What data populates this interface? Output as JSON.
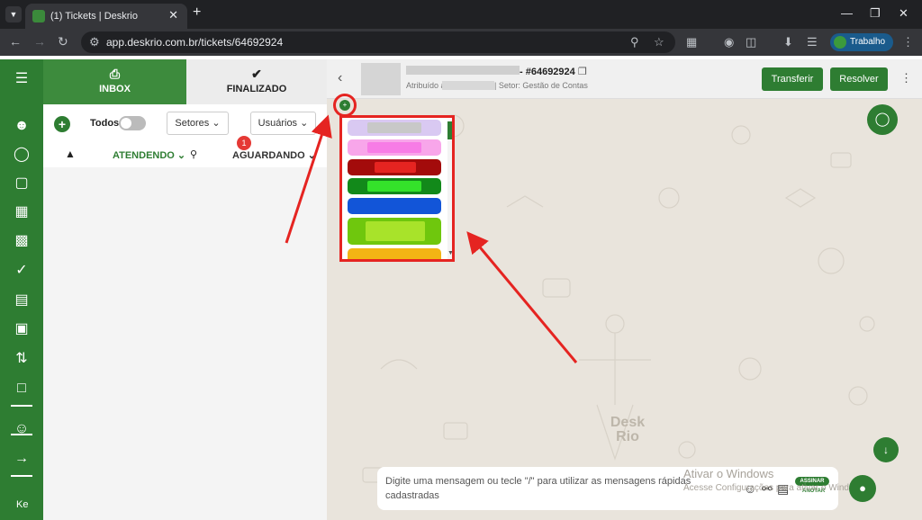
{
  "browser": {
    "tab_title": "(1) Tickets | Deskrio",
    "url": "app.deskrio.com.br/tickets/64692924",
    "profile_label": "Trabalho"
  },
  "rail": {
    "user_initials": "Ke",
    "icons": [
      "menu-icon",
      "user-icon",
      "chat-icon",
      "contacts-icon",
      "dashboard-icon",
      "kanban-icon",
      "check-icon",
      "calendar-icon",
      "quick-reply-icon",
      "flow-icon",
      "feedback-icon",
      "users-icon",
      "logout-icon"
    ]
  },
  "panel": {
    "tab_inbox": "INBOX",
    "tab_finalizado": "FINALIZADO",
    "todos_label": "Todos",
    "setores_label": "Setores",
    "usuarios_label": "Usuários",
    "atendendo_label": "ATENDENDO",
    "aguardando_label": "AGUARDANDO",
    "aguardando_count": "1"
  },
  "chat": {
    "ticket_id": "- #64692924",
    "assigned_prefix": "Atribuído a:",
    "sector_text": "| Setor: Gestão de Contas",
    "transfer_label": "Transferir",
    "resolve_label": "Resolver",
    "composer_placeholder": "Digite uma mensagem ou tecle \"/\" para utilizar as mensagens rápidas cadastradas",
    "assinar_label": "ASSINAR",
    "anotar_label": "ANOTAR",
    "mini_plus": "+",
    "brand_watermark": "Desk Rio"
  },
  "windows_watermark": {
    "line1": "Ativar o Windows",
    "line2": "Acesse Configurações para ativar o Windows."
  },
  "tag_colors": [
    {
      "outer": "#d9c9f2",
      "inner": "#c8c8c8"
    },
    {
      "outer": "#f8a6ea",
      "inner": "#f77ce6"
    },
    {
      "outer": "#a30b0b",
      "inner": "#e52421"
    },
    {
      "outer": "#12891a",
      "inner": "#34e22a"
    },
    {
      "outer": "#1255d8",
      "inner": "#1255d8"
    },
    {
      "outer": "#6fc70d",
      "inner": "#a8e32a"
    },
    {
      "outer": "#f3b414",
      "inner": "#f3b414"
    }
  ],
  "colors": {
    "brand_green": "#2e7d32",
    "annotation_red": "#e52421"
  }
}
